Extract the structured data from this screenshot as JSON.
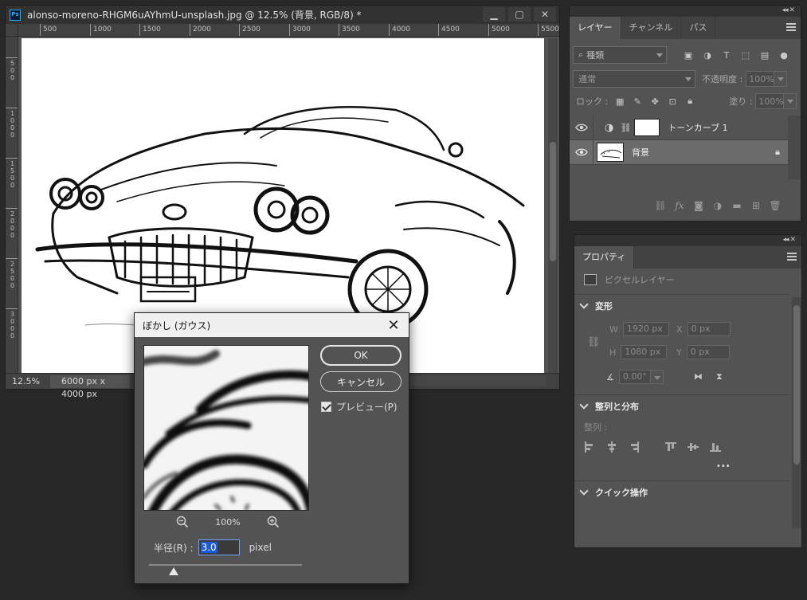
{
  "document": {
    "title": "alonso-moreno-RHGM6uAYhmU-unsplash.jpg @ 12.5% (背景, RGB/8) *",
    "ps_badge": "Ps",
    "window_buttons": {
      "minimize": "▁",
      "maximize": "▢",
      "close": "✕"
    },
    "ruler_h": [
      "500",
      "1000",
      "1500",
      "2000",
      "2500",
      "3000",
      "3500",
      "4000",
      "4500",
      "5000",
      "5500"
    ],
    "ruler_v": [
      "500",
      "1000",
      "1500",
      "2000",
      "2500",
      "3000"
    ],
    "zoom": "12.5%",
    "dimensions": "6000 px x 4000 px"
  },
  "dialog": {
    "title": "ぼかし (ガウス)",
    "close_icon": "✕",
    "ok_label": "OK",
    "cancel_label": "キャンセル",
    "preview_label": "プレビュー(P)",
    "preview_checked": true,
    "preview_zoom": "100%",
    "radius_label": "半径(R) :",
    "radius_value": "3.0",
    "radius_unit": "pixel"
  },
  "layers_panel": {
    "tabs": [
      "レイヤー",
      "チャンネル",
      "パス"
    ],
    "active_tab": "レイヤー",
    "filter_kind": "種類",
    "blend_mode": "通常",
    "opacity_label": "不透明度 :",
    "opacity_value": "100%",
    "lock_label": "ロック :",
    "fill_label": "塗り :",
    "fill_value": "100%",
    "layers": [
      {
        "name": "トーンカーブ 1",
        "visible": true,
        "selected": false
      },
      {
        "name": "背景",
        "visible": true,
        "selected": true,
        "locked": true
      }
    ]
  },
  "properties_panel": {
    "tab": "プロパティ",
    "kind": "ピクセルレイヤー",
    "transform_title": "変形",
    "w_label": "W",
    "w_value": "1920 px",
    "h_label": "H",
    "h_value": "1080 px",
    "x_label": "X",
    "x_value": "0 px",
    "y_label": "Y",
    "y_value": "0 px",
    "angle_value": "0.00°",
    "align_title": "整列と分布",
    "align_label": "整列 :",
    "more_label": "•••",
    "quick_title": "クイック操作"
  },
  "colors": {
    "app_bg": "#282828",
    "panel_bg": "#535353",
    "accent_blue": "#1c5bd7"
  }
}
